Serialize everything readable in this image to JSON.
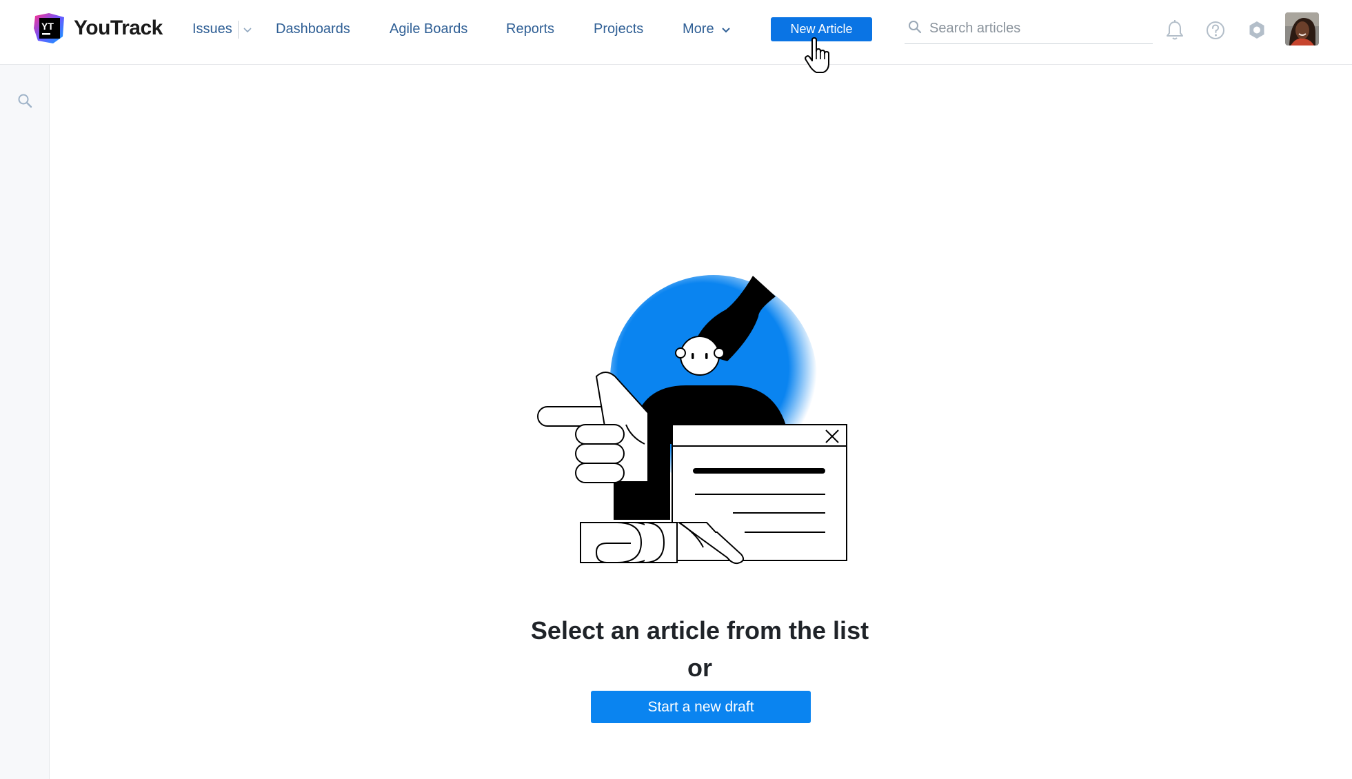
{
  "app": {
    "brand": "YouTrack"
  },
  "nav": {
    "items": [
      {
        "label": "Issues",
        "has_dropdown": true
      },
      {
        "label": "Dashboards"
      },
      {
        "label": "Agile Boards"
      },
      {
        "label": "Reports"
      },
      {
        "label": "Projects"
      },
      {
        "label": "More",
        "has_dropdown": true
      }
    ],
    "new_article_label": "New Article"
  },
  "search": {
    "placeholder": "Search articles",
    "value": ""
  },
  "header_icons": [
    "bell-icon",
    "help-icon",
    "settings-icon",
    "avatar"
  ],
  "sidebar": {
    "icons": [
      "search-icon"
    ]
  },
  "empty_state": {
    "title": "Select an article from the list",
    "or": "or",
    "button_label": "Start a new draft"
  },
  "colors": {
    "accent": "#0a74e4",
    "nav_link": "#2f5f95",
    "illustration_blue": "#0a84f0"
  }
}
